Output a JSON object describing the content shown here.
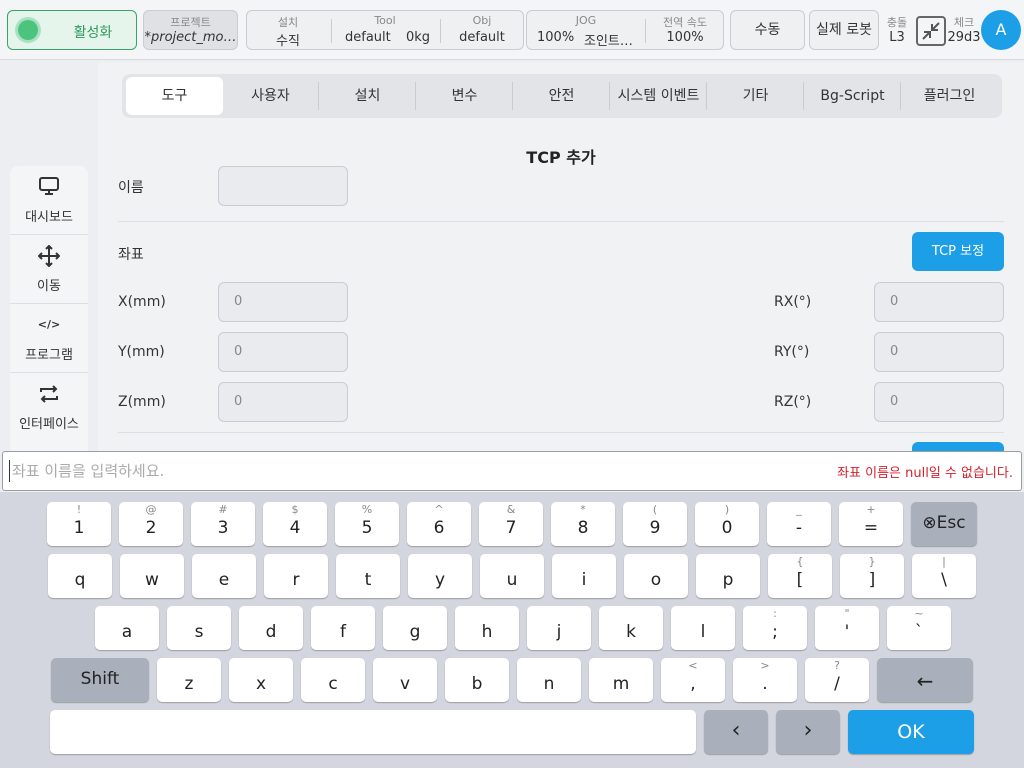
{
  "topbar": {
    "activate_label": "활성화",
    "project": {
      "label": "프로젝트",
      "value": "*project_mo…"
    },
    "install": {
      "label": "설치",
      "value": "수직"
    },
    "tool": {
      "label": "Tool",
      "name": "default",
      "weight": "0kg"
    },
    "obj": {
      "label": "Obj",
      "value": "default"
    },
    "jog": {
      "label": "JOG",
      "percent": "100%",
      "mode": "조인트…"
    },
    "global_speed": {
      "label": "전역 속도",
      "value": "100%"
    },
    "manual_label": "수동",
    "real_robot_label": "실제 로봇",
    "collision": {
      "label": "충돌",
      "value": "L3"
    },
    "check": {
      "label": "체크",
      "value": "29d3"
    },
    "avatar": "A"
  },
  "sidebar": {
    "items": [
      {
        "label": "대시보드",
        "icon": "monitor-icon"
      },
      {
        "label": "이동",
        "icon": "move-icon"
      },
      {
        "label": "프로그램",
        "icon": "code-icon"
      },
      {
        "label": "인터페이스",
        "icon": "interface-icon"
      }
    ]
  },
  "tabs": {
    "items": [
      "도구",
      "사용자",
      "설치",
      "변수",
      "안전",
      "시스템 이벤트",
      "기타",
      "Bg-Script",
      "플러그인"
    ],
    "active": "도구"
  },
  "form": {
    "title": "TCP 추가",
    "name_label": "이름",
    "name_value": "",
    "coords_label": "좌표",
    "tcp_calib_button": "TCP 보정",
    "x_label": "X(mm)",
    "x_value": "0",
    "y_label": "Y(mm)",
    "y_value": "0",
    "z_label": "Z(mm)",
    "z_value": "0",
    "rx_label": "RX(°)",
    "rx_value": "0",
    "ry_label": "RY(°)",
    "ry_value": "0",
    "rz_label": "RZ(°)",
    "rz_value": "0"
  },
  "keyboard": {
    "input_placeholder": "좌표 이름을 입력하세요.",
    "input_value": "",
    "error": "좌표 이름은 null일 수 없습니다.",
    "row1": [
      {
        "s": "!",
        "m": "1"
      },
      {
        "s": "@",
        "m": "2"
      },
      {
        "s": "#",
        "m": "3"
      },
      {
        "s": "$",
        "m": "4"
      },
      {
        "s": "%",
        "m": "5"
      },
      {
        "s": "^",
        "m": "6"
      },
      {
        "s": "&",
        "m": "7"
      },
      {
        "s": "*",
        "m": "8"
      },
      {
        "s": "(",
        "m": "9"
      },
      {
        "s": ")",
        "m": "0"
      },
      {
        "s": "_",
        "m": "-"
      },
      {
        "s": "+",
        "m": "="
      }
    ],
    "esc": "⊗Esc",
    "row2": [
      {
        "s": "",
        "m": "q"
      },
      {
        "s": "",
        "m": "w"
      },
      {
        "s": "",
        "m": "e"
      },
      {
        "s": "",
        "m": "r"
      },
      {
        "s": "",
        "m": "t"
      },
      {
        "s": "",
        "m": "y"
      },
      {
        "s": "",
        "m": "u"
      },
      {
        "s": "",
        "m": "i"
      },
      {
        "s": "",
        "m": "o"
      },
      {
        "s": "",
        "m": "p"
      },
      {
        "s": "{",
        "m": "["
      },
      {
        "s": "}",
        "m": "]"
      },
      {
        "s": "|",
        "m": "\\"
      }
    ],
    "row3": [
      {
        "s": "",
        "m": "a"
      },
      {
        "s": "",
        "m": "s"
      },
      {
        "s": "",
        "m": "d"
      },
      {
        "s": "",
        "m": "f"
      },
      {
        "s": "",
        "m": "g"
      },
      {
        "s": "",
        "m": "h"
      },
      {
        "s": "",
        "m": "j"
      },
      {
        "s": "",
        "m": "k"
      },
      {
        "s": "",
        "m": "l"
      },
      {
        "s": ":",
        "m": ";"
      },
      {
        "s": "\"",
        "m": "'"
      },
      {
        "s": "~",
        "m": "`"
      }
    ],
    "shift": "Shift",
    "row4": [
      {
        "s": "",
        "m": "z"
      },
      {
        "s": "",
        "m": "x"
      },
      {
        "s": "",
        "m": "c"
      },
      {
        "s": "",
        "m": "v"
      },
      {
        "s": "",
        "m": "b"
      },
      {
        "s": "",
        "m": "n"
      },
      {
        "s": "",
        "m": "m"
      },
      {
        "s": "<",
        "m": ","
      },
      {
        "s": ">",
        "m": "."
      },
      {
        "s": "?",
        "m": "/"
      }
    ],
    "backspace": "←",
    "left_arrow": "‹",
    "right_arrow": "›",
    "ok": "OK"
  }
}
